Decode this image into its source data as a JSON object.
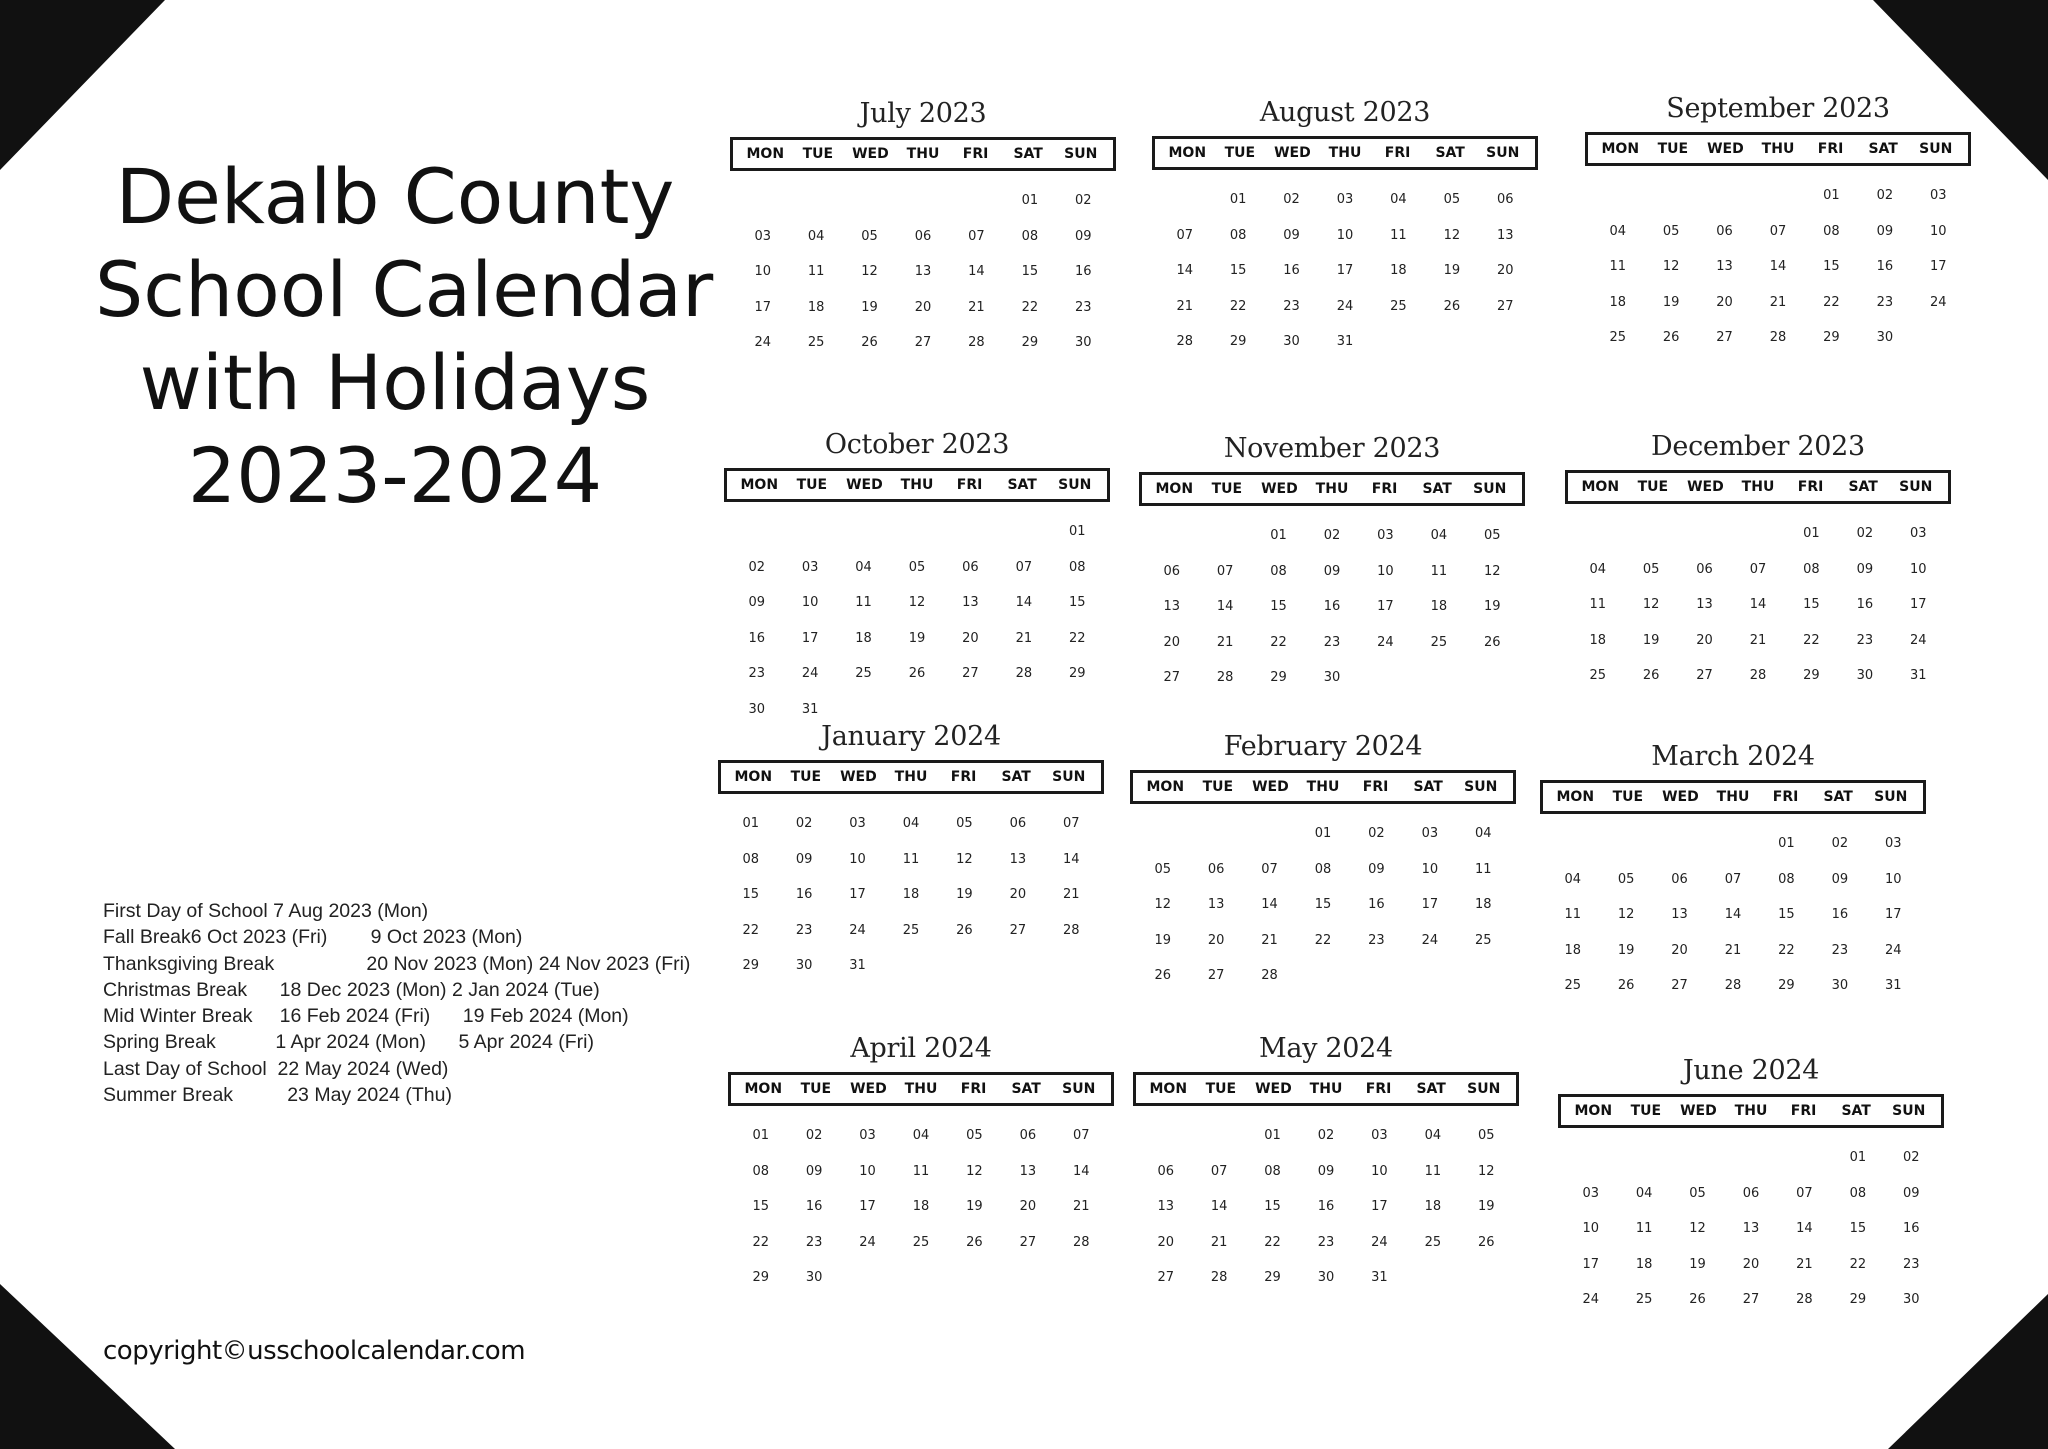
{
  "title": [
    "Dekalb County",
    "School Calendar",
    "with Holidays",
    "2023-2024"
  ],
  "weekdays": [
    "MON",
    "TUE",
    "WED",
    "THU",
    "FRI",
    "SAT",
    "SUN"
  ],
  "holidays": [
    {
      "text": "First Day of School 7 Aug 2023 (Mon)"
    },
    {
      "text": "Fall Break6 Oct 2023 (Fri)        9 Oct 2023 (Mon)"
    },
    {
      "text": "Thanksgiving Break                 20 Nov 2023 (Mon) 24 Nov 2023 (Fri)"
    },
    {
      "text": "Christmas Break      18 Dec 2023 (Mon) 2 Jan 2024 (Tue)"
    },
    {
      "text": "Mid Winter Break     16 Feb 2024 (Fri)      19 Feb 2024 (Mon)"
    },
    {
      "text": "Spring Break           1 Apr 2024 (Mon)      5 Apr 2024 (Fri)"
    },
    {
      "text": "Last Day of School  22 May 2024 (Wed)"
    },
    {
      "text": "Summer Break          23 May 2024 (Thu)"
    }
  ],
  "copyright": "copyright©usschoolcalendar.com",
  "months": [
    {
      "name": "July 2023",
      "offset": 5,
      "days": 30
    },
    {
      "name": "August 2023",
      "offset": 1,
      "days": 31
    },
    {
      "name": "September 2023",
      "offset": 4,
      "days": 30
    },
    {
      "name": "October 2023",
      "offset": 6,
      "days": 31
    },
    {
      "name": "November 2023",
      "offset": 2,
      "days": 30
    },
    {
      "name": "December 2023",
      "offset": 4,
      "days": 31
    },
    {
      "name": "January 2024",
      "offset": 0,
      "days": 31
    },
    {
      "name": "February 2024",
      "offset": 3,
      "days": 28
    },
    {
      "name": "March 2024",
      "offset": 4,
      "days": 31
    },
    {
      "name": "April 2024",
      "offset": 0,
      "days": 30
    },
    {
      "name": "May 2024",
      "offset": 2,
      "days": 31
    },
    {
      "name": "June 2024",
      "offset": 5,
      "days": 30
    }
  ]
}
